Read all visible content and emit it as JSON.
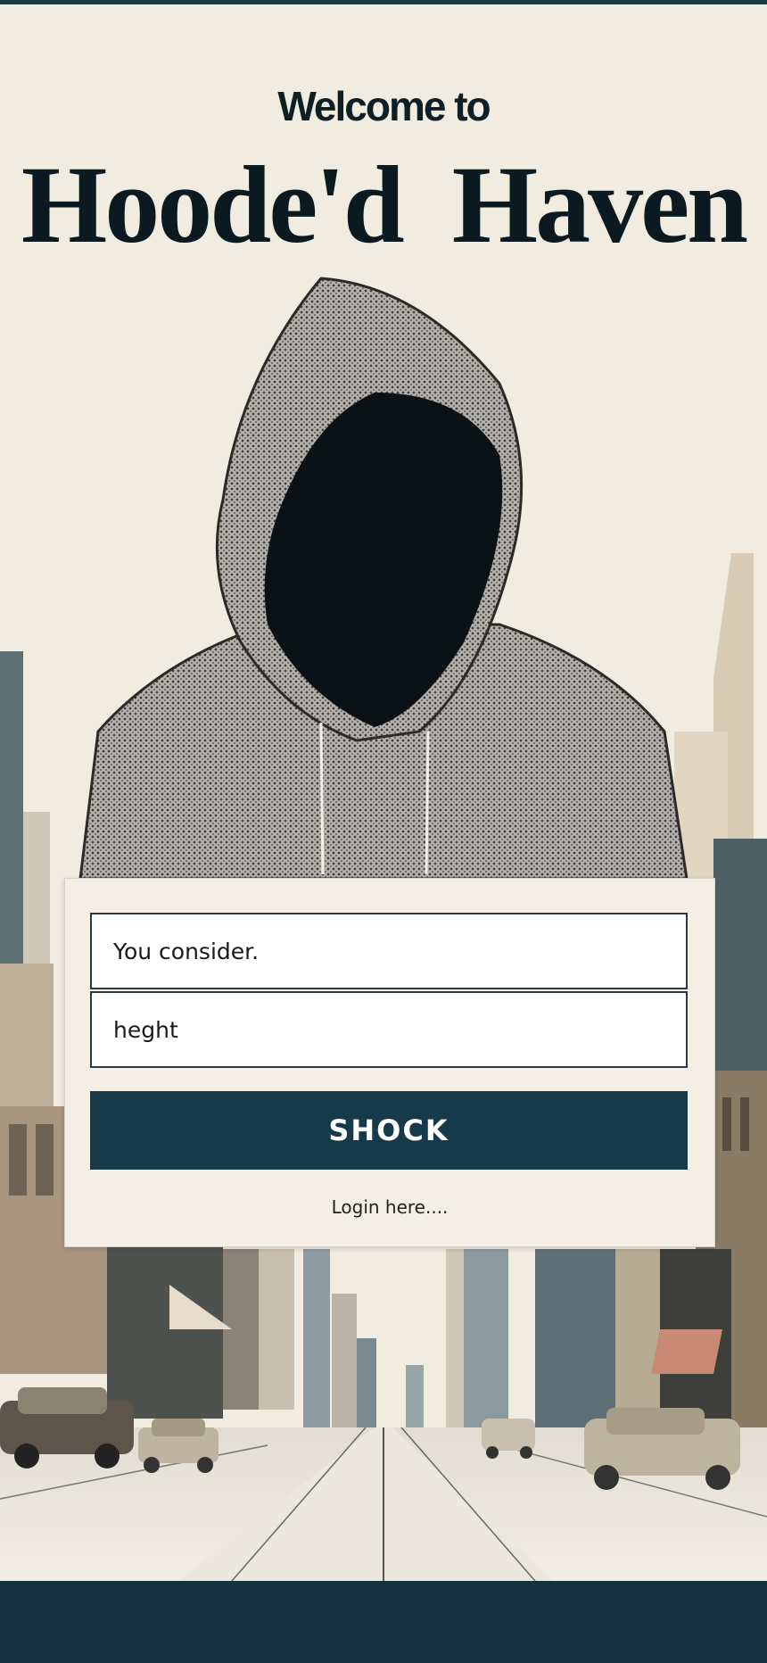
{
  "header": {
    "welcome": "Welcome to",
    "brand": "Hoode'd  Haven"
  },
  "form": {
    "field1_value": "You consider.",
    "field2_value": "heght",
    "submit_label": "SHOCK",
    "login_link": "Login here...."
  },
  "colors": {
    "background": "#f1ece0",
    "accent": "#163a49",
    "text": "#0b1a20"
  },
  "illustration": {
    "subject": "hooded-figure-icon",
    "scene": "city-street-icon"
  }
}
